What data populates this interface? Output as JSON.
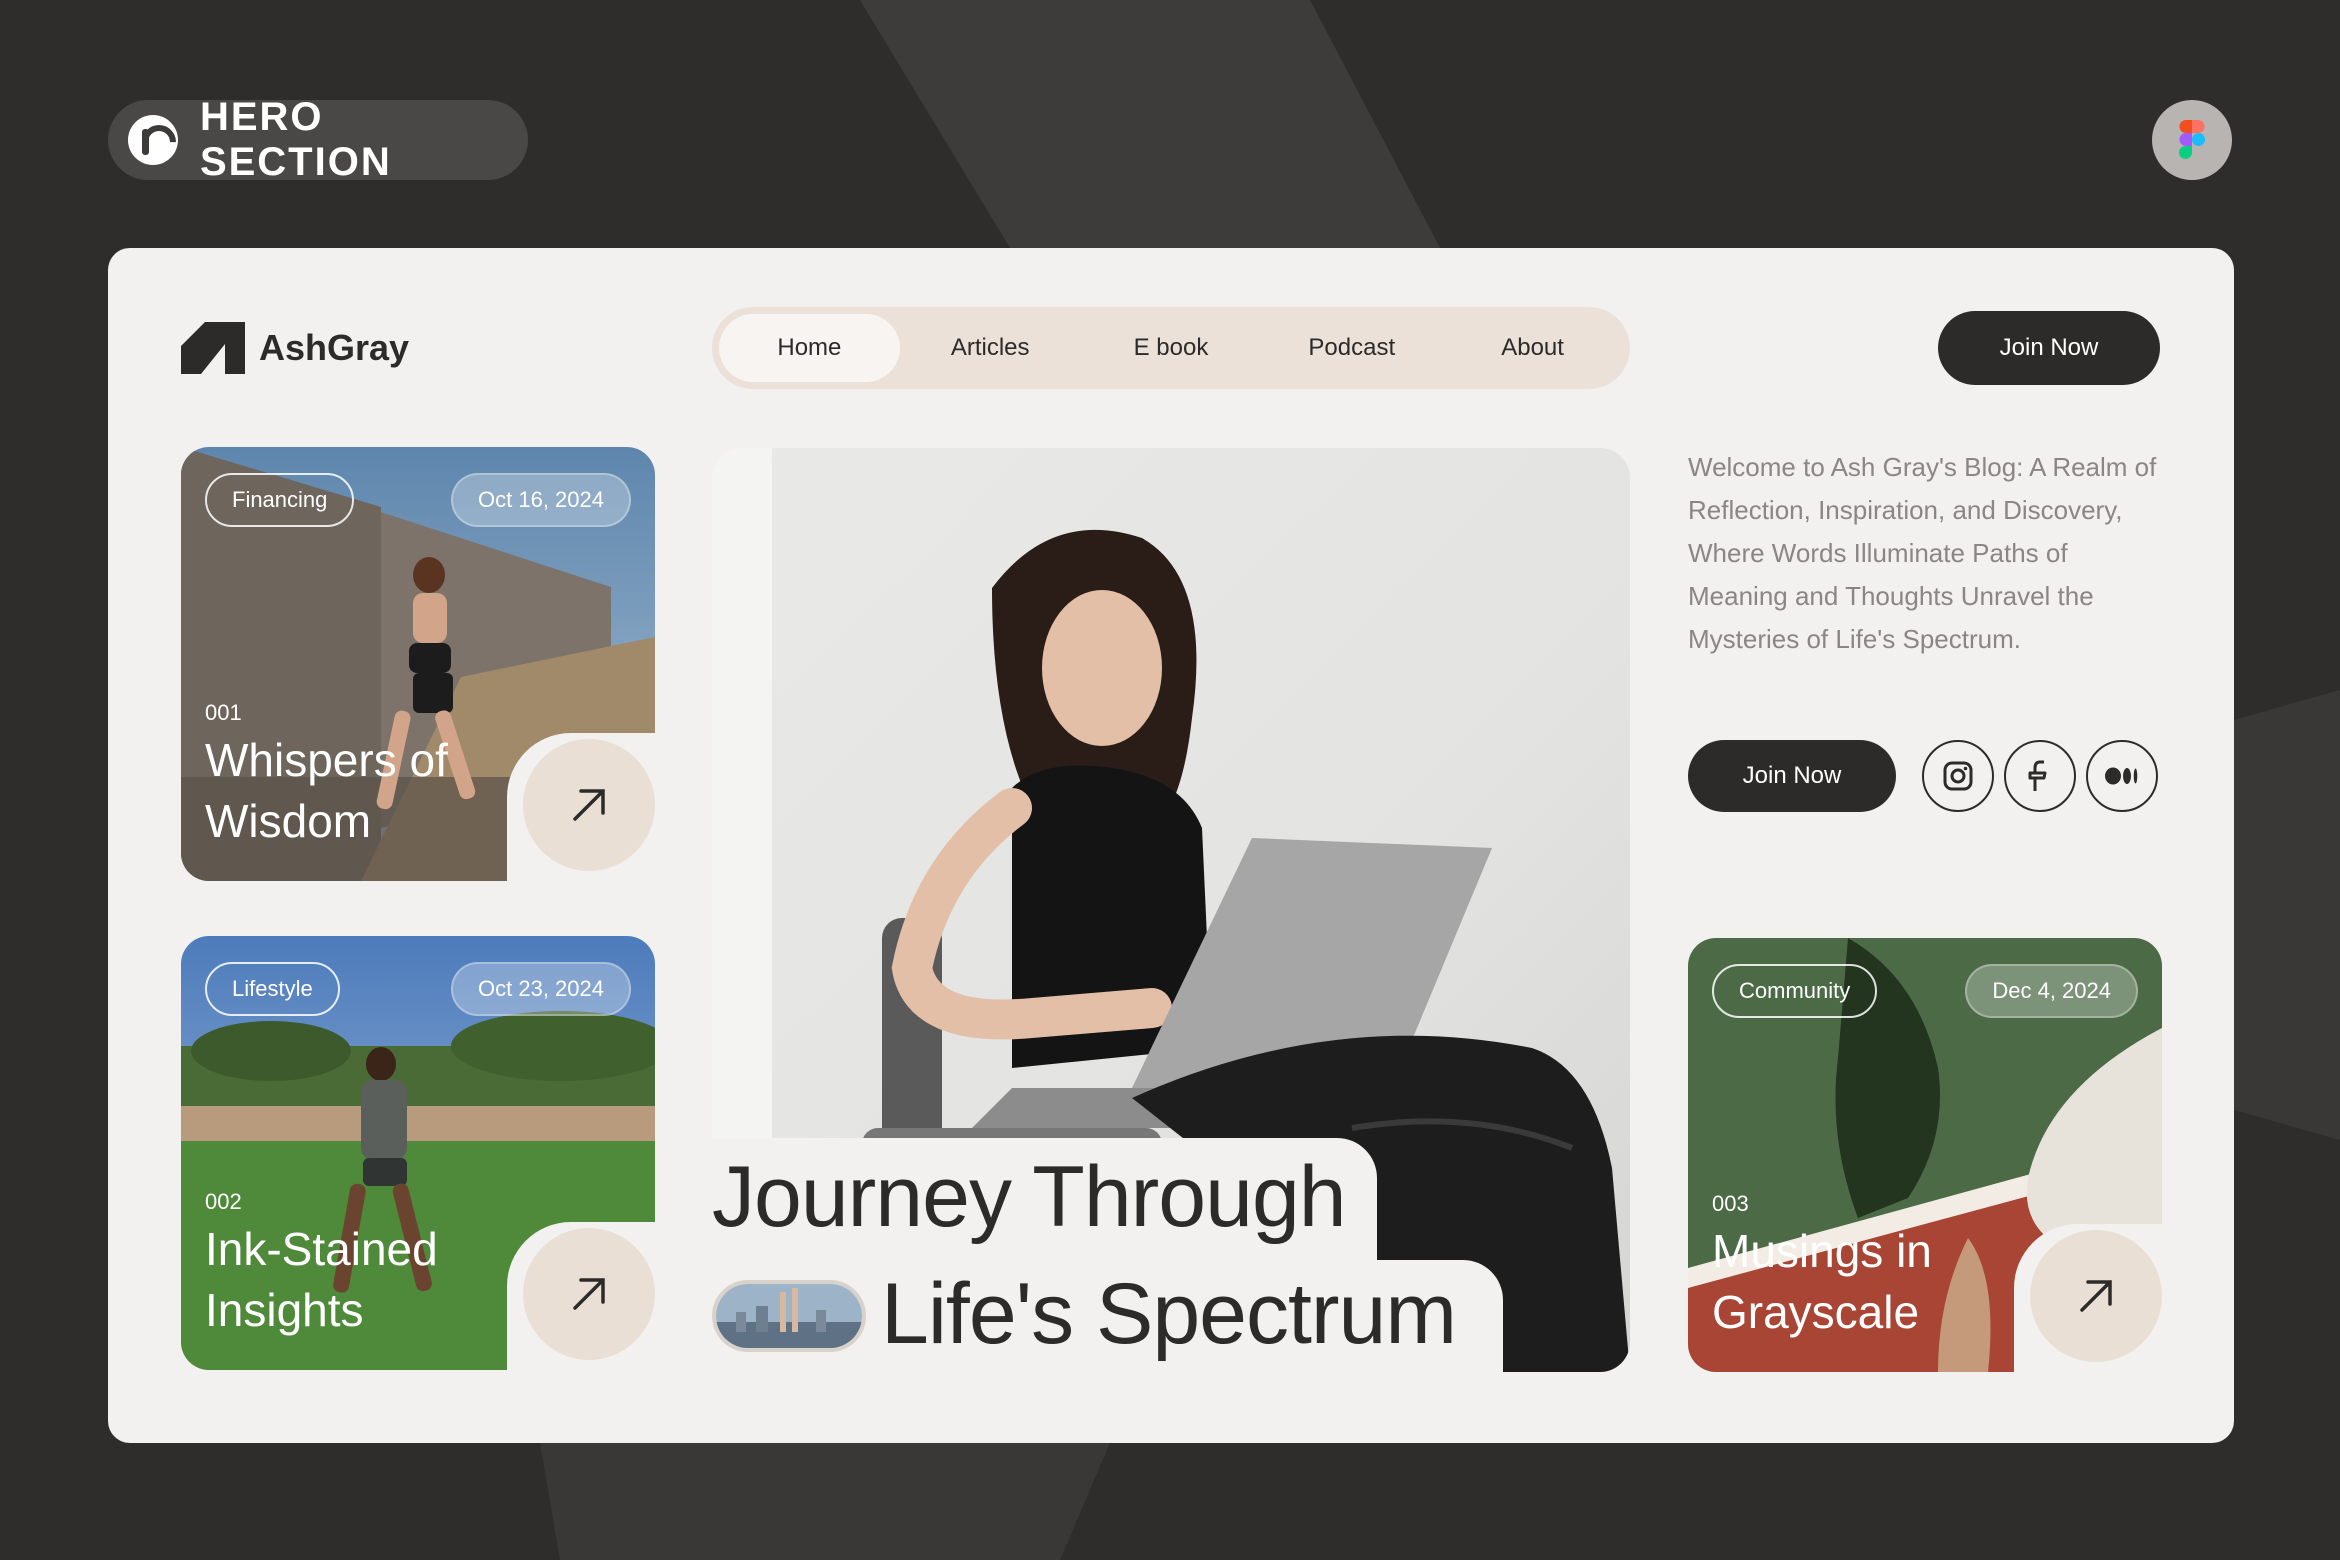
{
  "badge": {
    "label": "HERO SECTION",
    "logo_icon": "p-logo-icon"
  },
  "figma_icon": "figma-icon",
  "brand": {
    "name": "AshGray"
  },
  "nav": {
    "items": [
      {
        "label": "Home",
        "active": true
      },
      {
        "label": "Articles",
        "active": false
      },
      {
        "label": "E book",
        "active": false
      },
      {
        "label": "Podcast",
        "active": false
      },
      {
        "label": "About",
        "active": false
      }
    ]
  },
  "header": {
    "join_label": "Join Now"
  },
  "cards": [
    {
      "category": "Financing",
      "date": "Oct 16, 2024",
      "number": "001",
      "title": "Whispers of Wisdom",
      "arrow_icon": "arrow-up-right-icon"
    },
    {
      "category": "Lifestyle",
      "date": "Oct 23, 2024",
      "number": "002",
      "title": "Ink-Stained Insights",
      "arrow_icon": "arrow-up-right-icon"
    },
    {
      "category": "Community",
      "date": "Dec 4, 2024",
      "number": "003",
      "title": "Musings in Grayscale",
      "arrow_icon": "arrow-up-right-icon"
    }
  ],
  "hero": {
    "title_line1": "Journey Through",
    "title_line2": "Life's Spectrum"
  },
  "intro": {
    "text": "Welcome to Ash Gray's Blog: A Realm of Reflection, Inspiration, and Discovery, Where Words Illuminate Paths of Meaning and Thoughts Unravel the Mysteries of Life's Spectrum.",
    "join_label": "Join Now",
    "social": [
      "instagram-icon",
      "facebook-icon",
      "medium-icon"
    ]
  },
  "colors": {
    "background": "#2f2d2c",
    "card": "#f2f1ef",
    "accent": "#ebe1d8",
    "dark": "#2d2b2a"
  }
}
